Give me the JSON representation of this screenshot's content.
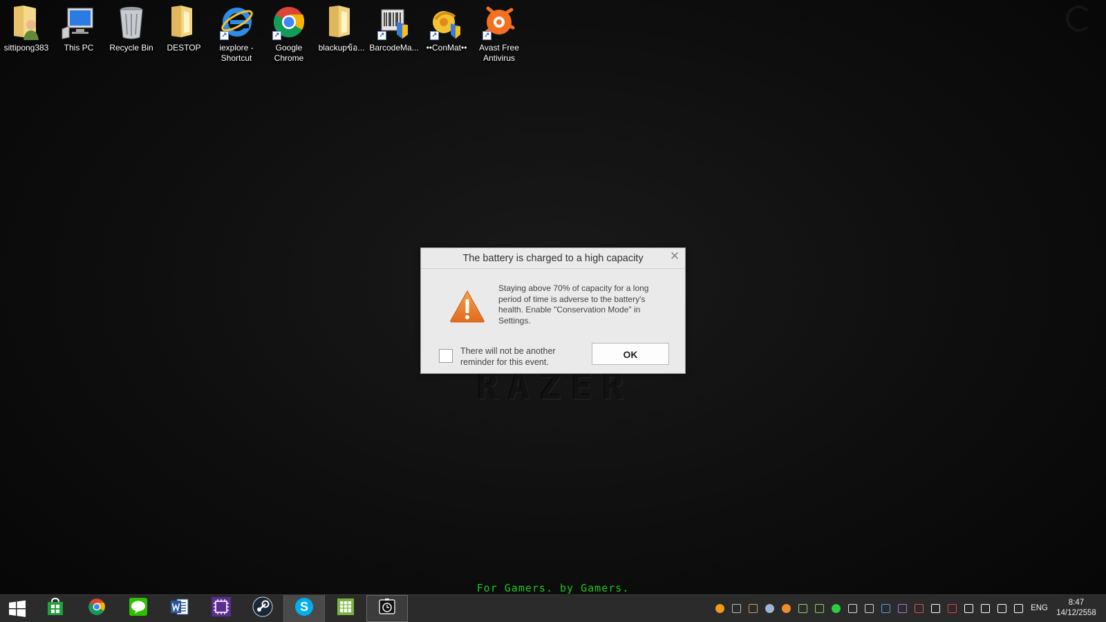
{
  "desktop": {
    "icons": [
      {
        "label": "sittipong383",
        "icon": "user-folder-icon",
        "shortcut": false
      },
      {
        "label": "This PC",
        "icon": "computer-icon",
        "shortcut": false
      },
      {
        "label": "Recycle Bin",
        "icon": "recycle-bin-icon",
        "shortcut": false
      },
      {
        "label": "DESTOP",
        "icon": "folder-icon",
        "shortcut": false
      },
      {
        "label": "iexplore - Shortcut",
        "icon": "internet-explorer-icon",
        "shortcut": true
      },
      {
        "label": "Google Chrome",
        "icon": "chrome-icon",
        "shortcut": true
      },
      {
        "label": "blackupข้อ...",
        "icon": "folder-icon",
        "shortcut": false
      },
      {
        "label": "BarcodeMa...",
        "icon": "barcode-maker-icon",
        "shortcut": true
      },
      {
        "label": "••ConMat••",
        "icon": "conmat-icon",
        "shortcut": true
      },
      {
        "label": "Avast Free Antivirus",
        "icon": "avast-icon",
        "shortcut": true
      }
    ],
    "wallpaper_logo": "RAZER",
    "tagline": "For Gamers. by Gamers."
  },
  "dialog": {
    "title": "The battery is charged to a high capacity",
    "close_glyph": "✕",
    "message": "Staying above 70% of capacity for a long period of time is adverse to the battery's health. Enable \"Conservation Mode\" in Settings.",
    "checkbox_label": "There will not be another reminder for this event.",
    "checkbox_checked": false,
    "ok_label": "OK",
    "warning_color": "#e8792a"
  },
  "taskbar": {
    "apps": [
      {
        "name": "store",
        "icon": "windows-store-icon",
        "state": "pinned"
      },
      {
        "name": "chrome",
        "icon": "chrome-icon",
        "state": "pinned"
      },
      {
        "name": "line",
        "icon": "line-icon",
        "state": "pinned"
      },
      {
        "name": "word",
        "icon": "word-icon",
        "state": "pinned"
      },
      {
        "name": "cpu-app",
        "icon": "chip-icon",
        "state": "pinned"
      },
      {
        "name": "steam",
        "icon": "steam-icon",
        "state": "pinned"
      },
      {
        "name": "skype",
        "icon": "skype-icon",
        "state": "active"
      },
      {
        "name": "spreadsheet",
        "icon": "spreadsheet-icon",
        "state": "pinned"
      },
      {
        "name": "battery-app",
        "icon": "battery-app-icon",
        "state": "open"
      }
    ],
    "tray": [
      "avast-tray-icon",
      "window-tray-icon",
      "fan-tray-icon",
      "steam-tray-icon",
      "orange-ball-tray-icon",
      "network-share-tray-icon",
      "leaf-tray-icon",
      "razer-tray-icon",
      "camera-tray-icon",
      "monitor-tray-icon",
      "display-tray-icon",
      "purple-app-tray-icon",
      "volume-mute-tray-icon",
      "bluetooth-tray-icon",
      "flag-error-tray-icon",
      "windows-tray-icon",
      "power-tray-icon",
      "network-tray-icon",
      "volume-tray-icon"
    ],
    "language": "ENG",
    "time": "8:47",
    "date": "14/12/2558"
  }
}
